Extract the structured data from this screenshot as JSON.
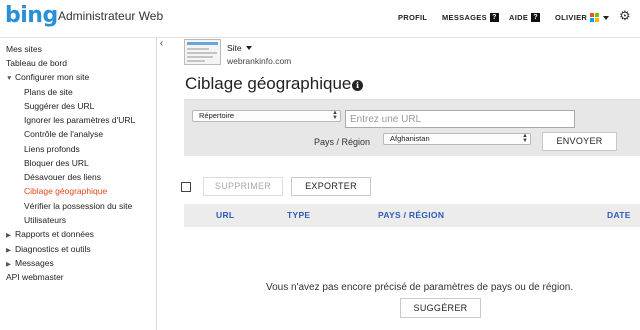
{
  "header": {
    "logo_text": "bing",
    "app_title": "Administrateur Web",
    "nav": {
      "profil": "PROFIL",
      "messages": "MESSAGES",
      "messages_badge": "?",
      "aide": "AIDE",
      "aide_badge": "?",
      "user": "OLIVIER"
    },
    "settings_icon": "gear-icon"
  },
  "sidebar": {
    "collapse_glyph": "‹",
    "items": [
      {
        "label": "Mes sites"
      },
      {
        "label": "Tableau de bord"
      },
      {
        "label": "Configurer mon site"
      },
      {
        "label": "Plans de site"
      },
      {
        "label": "Suggérer des URL"
      },
      {
        "label": "Ignorer les paramètres d'URL"
      },
      {
        "label": "Contrôle de l'analyse"
      },
      {
        "label": "Liens profonds"
      },
      {
        "label": "Bloquer des URL"
      },
      {
        "label": "Désavouer des liens"
      },
      {
        "label": "Ciblage géographique"
      },
      {
        "label": "Vérifier la possession du site"
      },
      {
        "label": "Utilisateurs"
      },
      {
        "label": "Rapports et données"
      },
      {
        "label": "Diagnostics et outils"
      },
      {
        "label": "Messages"
      },
      {
        "label": "API webmaster"
      }
    ],
    "active_color": "#e8441a"
  },
  "site": {
    "label": "Site",
    "url": "webrankinfo.com"
  },
  "page": {
    "title": "Ciblage géographique",
    "info_glyph": "i"
  },
  "form": {
    "type_select": "Répertoire",
    "url_placeholder": "Entrez une URL",
    "country_label": "Pays / Région",
    "country_select": "Afghanistan",
    "submit": "ENVOYER"
  },
  "actions": {
    "delete": "SUPPRIMER",
    "export": "EXPORTER"
  },
  "table": {
    "columns": [
      "URL",
      "TYPE",
      "PAYS / RÉGION",
      "DATE"
    ],
    "empty_message": "Vous n'avez pas encore précisé de paramètres de pays ou de région.",
    "suggest": "SUGGÉRER"
  },
  "colors": {
    "brand": "#2a8fd6",
    "column_header": "#2d5bb5"
  }
}
